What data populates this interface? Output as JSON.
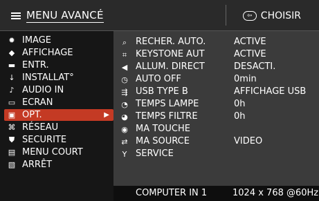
{
  "header": {
    "title": "MENU AVANCÉ",
    "choose_label": "CHOISIR",
    "choose_icon_glyph": "⇦",
    "menu_icon": "menu-icon"
  },
  "sidebar": {
    "items": [
      {
        "label": "IMAGE",
        "icon": "brightness-icon",
        "glyph": "✹"
      },
      {
        "label": "AFFICHAGE",
        "icon": "display-icon",
        "glyph": "◆"
      },
      {
        "label": "ENTR.",
        "icon": "input-icon",
        "glyph": "▬"
      },
      {
        "label": "INSTALLAT°",
        "icon": "install-icon",
        "glyph": "↓"
      },
      {
        "label": "AUDIO IN",
        "icon": "audio-icon",
        "glyph": "♪"
      },
      {
        "label": "ECRAN",
        "icon": "screen-icon",
        "glyph": "▭"
      },
      {
        "label": "OPT.",
        "icon": "option-icon",
        "glyph": "▣",
        "selected": true
      },
      {
        "label": "RÉSEAU",
        "icon": "network-icon",
        "glyph": "⌘"
      },
      {
        "label": "SECURITE",
        "icon": "security-icon",
        "glyph": "⛊"
      },
      {
        "label": "MENU COURT",
        "icon": "short-menu-icon",
        "glyph": "▤"
      },
      {
        "label": "ARRÊT",
        "icon": "exit-icon",
        "glyph": "▧"
      }
    ]
  },
  "options": {
    "rows": [
      {
        "label": "RECHER. AUTO.",
        "value": "ACTIVE",
        "icon": "auto-search-icon",
        "glyph": "⌕"
      },
      {
        "label": "KEYSTONE AUT",
        "value": "ACTIVE",
        "icon": "keystone-icon",
        "glyph": "⌗"
      },
      {
        "label": "ALLUM. DIRECT",
        "value": "DESACTI.",
        "icon": "direct-power-icon",
        "glyph": "◀"
      },
      {
        "label": "AUTO OFF",
        "value": "0min",
        "icon": "auto-off-icon",
        "glyph": "◷"
      },
      {
        "label": "USB TYPE B",
        "value": "AFFICHAGE USB",
        "icon": "usb-icon",
        "glyph": "⇶"
      },
      {
        "label": "TEMPS LAMPE",
        "value": "0h",
        "icon": "lamp-time-icon",
        "glyph": "◔"
      },
      {
        "label": "TEMPS FILTRE",
        "value": "0h",
        "icon": "filter-time-icon",
        "glyph": "◕"
      },
      {
        "label": "MA TOUCHE",
        "value": "",
        "icon": "my-button-icon",
        "glyph": "◉"
      },
      {
        "label": "MA SOURCE",
        "value": "VIDEO",
        "icon": "my-source-icon",
        "glyph": "⇄"
      },
      {
        "label": "SERVICE",
        "value": "",
        "icon": "service-icon",
        "glyph": "Y"
      }
    ]
  },
  "footer": {
    "source": "COMPUTER IN 1",
    "resolution": "1024 x 768 @60Hz"
  },
  "colors": {
    "selected": "#c43a24",
    "panel": "#3b3b3b",
    "sidebar": "#161616"
  }
}
